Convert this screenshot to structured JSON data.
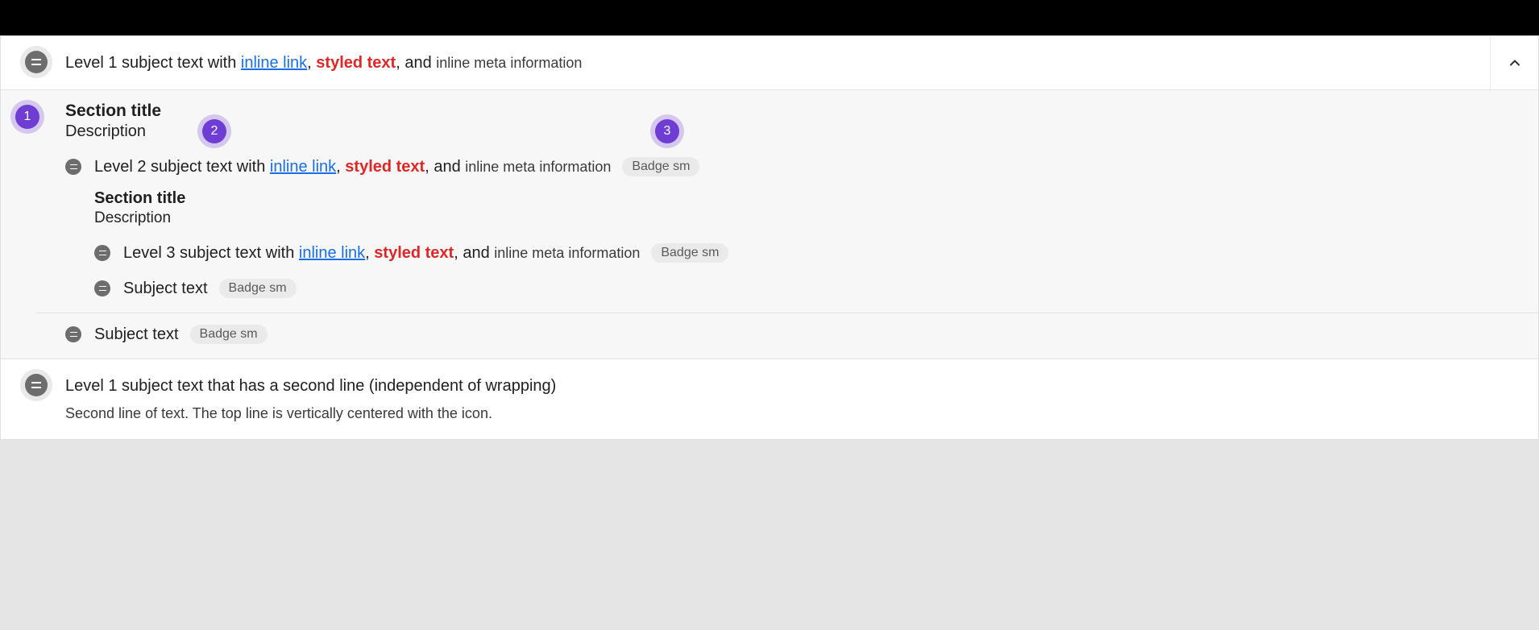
{
  "row1": {
    "prefix": "Level 1 subject text with ",
    "link": "inline link",
    "after_link": ", ",
    "styled": "styled text",
    "after_styled": ", and ",
    "meta": "inline meta information"
  },
  "section1": {
    "title": "Section title",
    "desc": "Description"
  },
  "level2": {
    "prefix": "Level 2 subject text with ",
    "link": "inline link",
    "after_link": ", ",
    "styled": "styled text",
    "after_styled": ", and ",
    "meta": "inline meta information",
    "badge": "Badge sm"
  },
  "section2": {
    "title": "Section title",
    "desc": "Description"
  },
  "level3": {
    "prefix": "Level 3 subject text with ",
    "link": "inline link",
    "after_link": ", ",
    "styled": "styled text",
    "after_styled": ", and ",
    "meta": "inline meta information",
    "badge": "Badge sm"
  },
  "l3_subject": {
    "text": "Subject text",
    "badge": "Badge sm"
  },
  "l2_subject": {
    "text": "Subject text",
    "badge": "Badge sm"
  },
  "row3": {
    "line1": "Level 1 subject text that has a second line (independent of wrapping)",
    "line2": "Second line of text. The top line is vertically centered with the icon."
  },
  "annotations": {
    "a1": "1",
    "a2": "2",
    "a3": "3"
  }
}
